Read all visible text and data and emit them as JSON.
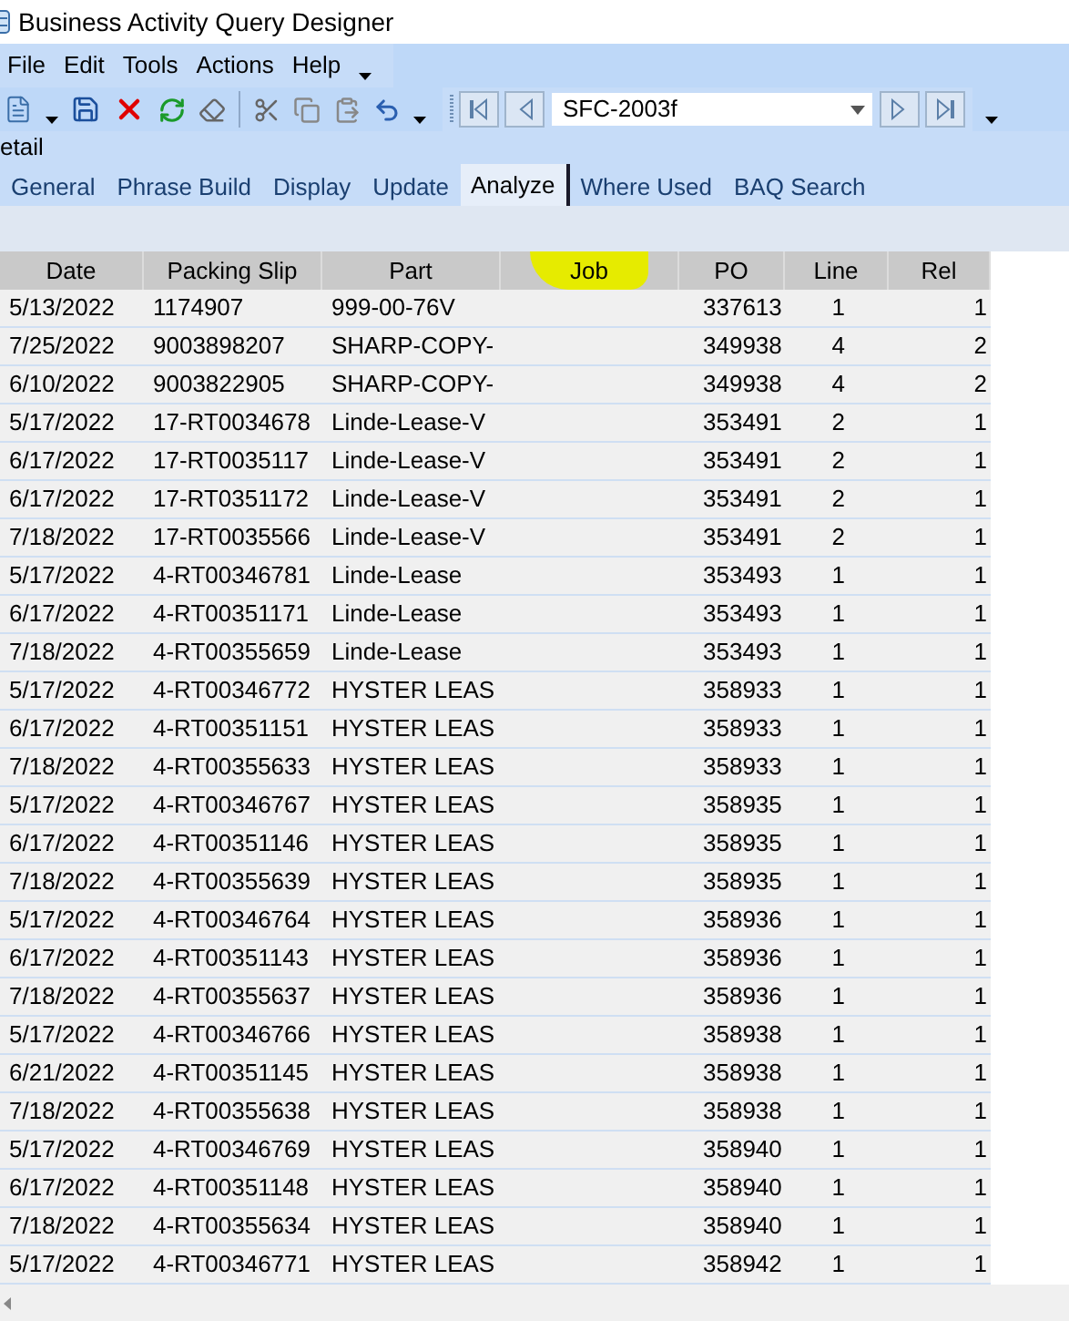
{
  "window": {
    "title": "Business Activity Query Designer"
  },
  "menu": [
    "File",
    "Edit",
    "Tools",
    "Actions",
    "Help"
  ],
  "toolbar": {
    "record_field": {
      "value": "SFC-2003f"
    }
  },
  "panel_title": "etail",
  "tabs": [
    {
      "label": "General",
      "selected": false
    },
    {
      "label": "Phrase Build",
      "selected": false
    },
    {
      "label": "Display",
      "selected": false
    },
    {
      "label": "Update",
      "selected": false
    },
    {
      "label": "Analyze",
      "selected": true
    },
    {
      "label": "Where Used",
      "selected": false
    },
    {
      "label": "BAQ Search",
      "selected": false
    }
  ],
  "table": {
    "columns": [
      {
        "label": "Date"
      },
      {
        "label": "Packing Slip"
      },
      {
        "label": "Part"
      },
      {
        "label": "Job"
      },
      {
        "label": "PO"
      },
      {
        "label": "Line"
      },
      {
        "label": "Rel"
      }
    ],
    "rows": [
      {
        "date": "5/13/2022",
        "packing_slip": "1174907",
        "part": "999-00-76V",
        "po": "337613",
        "line": "1",
        "rel": "1"
      },
      {
        "date": "7/25/2022",
        "packing_slip": "9003898207",
        "part": "SHARP-COPY-",
        "po": "349938",
        "line": "4",
        "rel": "2"
      },
      {
        "date": "6/10/2022",
        "packing_slip": "9003822905",
        "part": "SHARP-COPY-",
        "po": "349938",
        "line": "4",
        "rel": "2"
      },
      {
        "date": "5/17/2022",
        "packing_slip": "17-RT0034678",
        "part": "Linde-Lease-V",
        "po": "353491",
        "line": "2",
        "rel": "1"
      },
      {
        "date": "6/17/2022",
        "packing_slip": "17-RT0035117",
        "part": "Linde-Lease-V",
        "po": "353491",
        "line": "2",
        "rel": "1"
      },
      {
        "date": "6/17/2022",
        "packing_slip": "17-RT0351172",
        "part": "Linde-Lease-V",
        "po": "353491",
        "line": "2",
        "rel": "1"
      },
      {
        "date": "7/18/2022",
        "packing_slip": "17-RT0035566",
        "part": "Linde-Lease-V",
        "po": "353491",
        "line": "2",
        "rel": "1"
      },
      {
        "date": "5/17/2022",
        "packing_slip": "4-RT00346781",
        "part": "Linde-Lease",
        "po": "353493",
        "line": "1",
        "rel": "1"
      },
      {
        "date": "6/17/2022",
        "packing_slip": "4-RT00351171",
        "part": "Linde-Lease",
        "po": "353493",
        "line": "1",
        "rel": "1"
      },
      {
        "date": "7/18/2022",
        "packing_slip": "4-RT00355659",
        "part": "Linde-Lease",
        "po": "353493",
        "line": "1",
        "rel": "1"
      },
      {
        "date": "5/17/2022",
        "packing_slip": "4-RT00346772",
        "part": "HYSTER LEAS",
        "po": "358933",
        "line": "1",
        "rel": "1"
      },
      {
        "date": "6/17/2022",
        "packing_slip": "4-RT00351151",
        "part": "HYSTER LEAS",
        "po": "358933",
        "line": "1",
        "rel": "1"
      },
      {
        "date": "7/18/2022",
        "packing_slip": "4-RT00355633",
        "part": "HYSTER LEAS",
        "po": "358933",
        "line": "1",
        "rel": "1"
      },
      {
        "date": "5/17/2022",
        "packing_slip": "4-RT00346767",
        "part": "HYSTER LEAS",
        "po": "358935",
        "line": "1",
        "rel": "1"
      },
      {
        "date": "6/17/2022",
        "packing_slip": "4-RT00351146",
        "part": "HYSTER LEAS",
        "po": "358935",
        "line": "1",
        "rel": "1"
      },
      {
        "date": "7/18/2022",
        "packing_slip": "4-RT00355639",
        "part": "HYSTER LEAS",
        "po": "358935",
        "line": "1",
        "rel": "1"
      },
      {
        "date": "5/17/2022",
        "packing_slip": "4-RT00346764",
        "part": "HYSTER LEAS",
        "po": "358936",
        "line": "1",
        "rel": "1"
      },
      {
        "date": "6/17/2022",
        "packing_slip": "4-RT00351143",
        "part": "HYSTER LEAS",
        "po": "358936",
        "line": "1",
        "rel": "1"
      },
      {
        "date": "7/18/2022",
        "packing_slip": "4-RT00355637",
        "part": "HYSTER LEAS",
        "po": "358936",
        "line": "1",
        "rel": "1"
      },
      {
        "date": "5/17/2022",
        "packing_slip": "4-RT00346766",
        "part": "HYSTER LEAS",
        "po": "358938",
        "line": "1",
        "rel": "1"
      },
      {
        "date": "6/21/2022",
        "packing_slip": "4-RT00351145",
        "part": "HYSTER LEAS",
        "po": "358938",
        "line": "1",
        "rel": "1"
      },
      {
        "date": "7/18/2022",
        "packing_slip": "4-RT00355638",
        "part": "HYSTER LEAS",
        "po": "358938",
        "line": "1",
        "rel": "1"
      },
      {
        "date": "5/17/2022",
        "packing_slip": "4-RT00346769",
        "part": "HYSTER LEAS",
        "po": "358940",
        "line": "1",
        "rel": "1"
      },
      {
        "date": "6/17/2022",
        "packing_slip": "4-RT00351148",
        "part": "HYSTER LEAS",
        "po": "358940",
        "line": "1",
        "rel": "1"
      },
      {
        "date": "7/18/2022",
        "packing_slip": "4-RT00355634",
        "part": "HYSTER LEAS",
        "po": "358940",
        "line": "1",
        "rel": "1"
      },
      {
        "date": "5/17/2022",
        "packing_slip": "4-RT00346771",
        "part": "HYSTER LEAS",
        "po": "358942",
        "line": "1",
        "rel": "1"
      }
    ]
  }
}
